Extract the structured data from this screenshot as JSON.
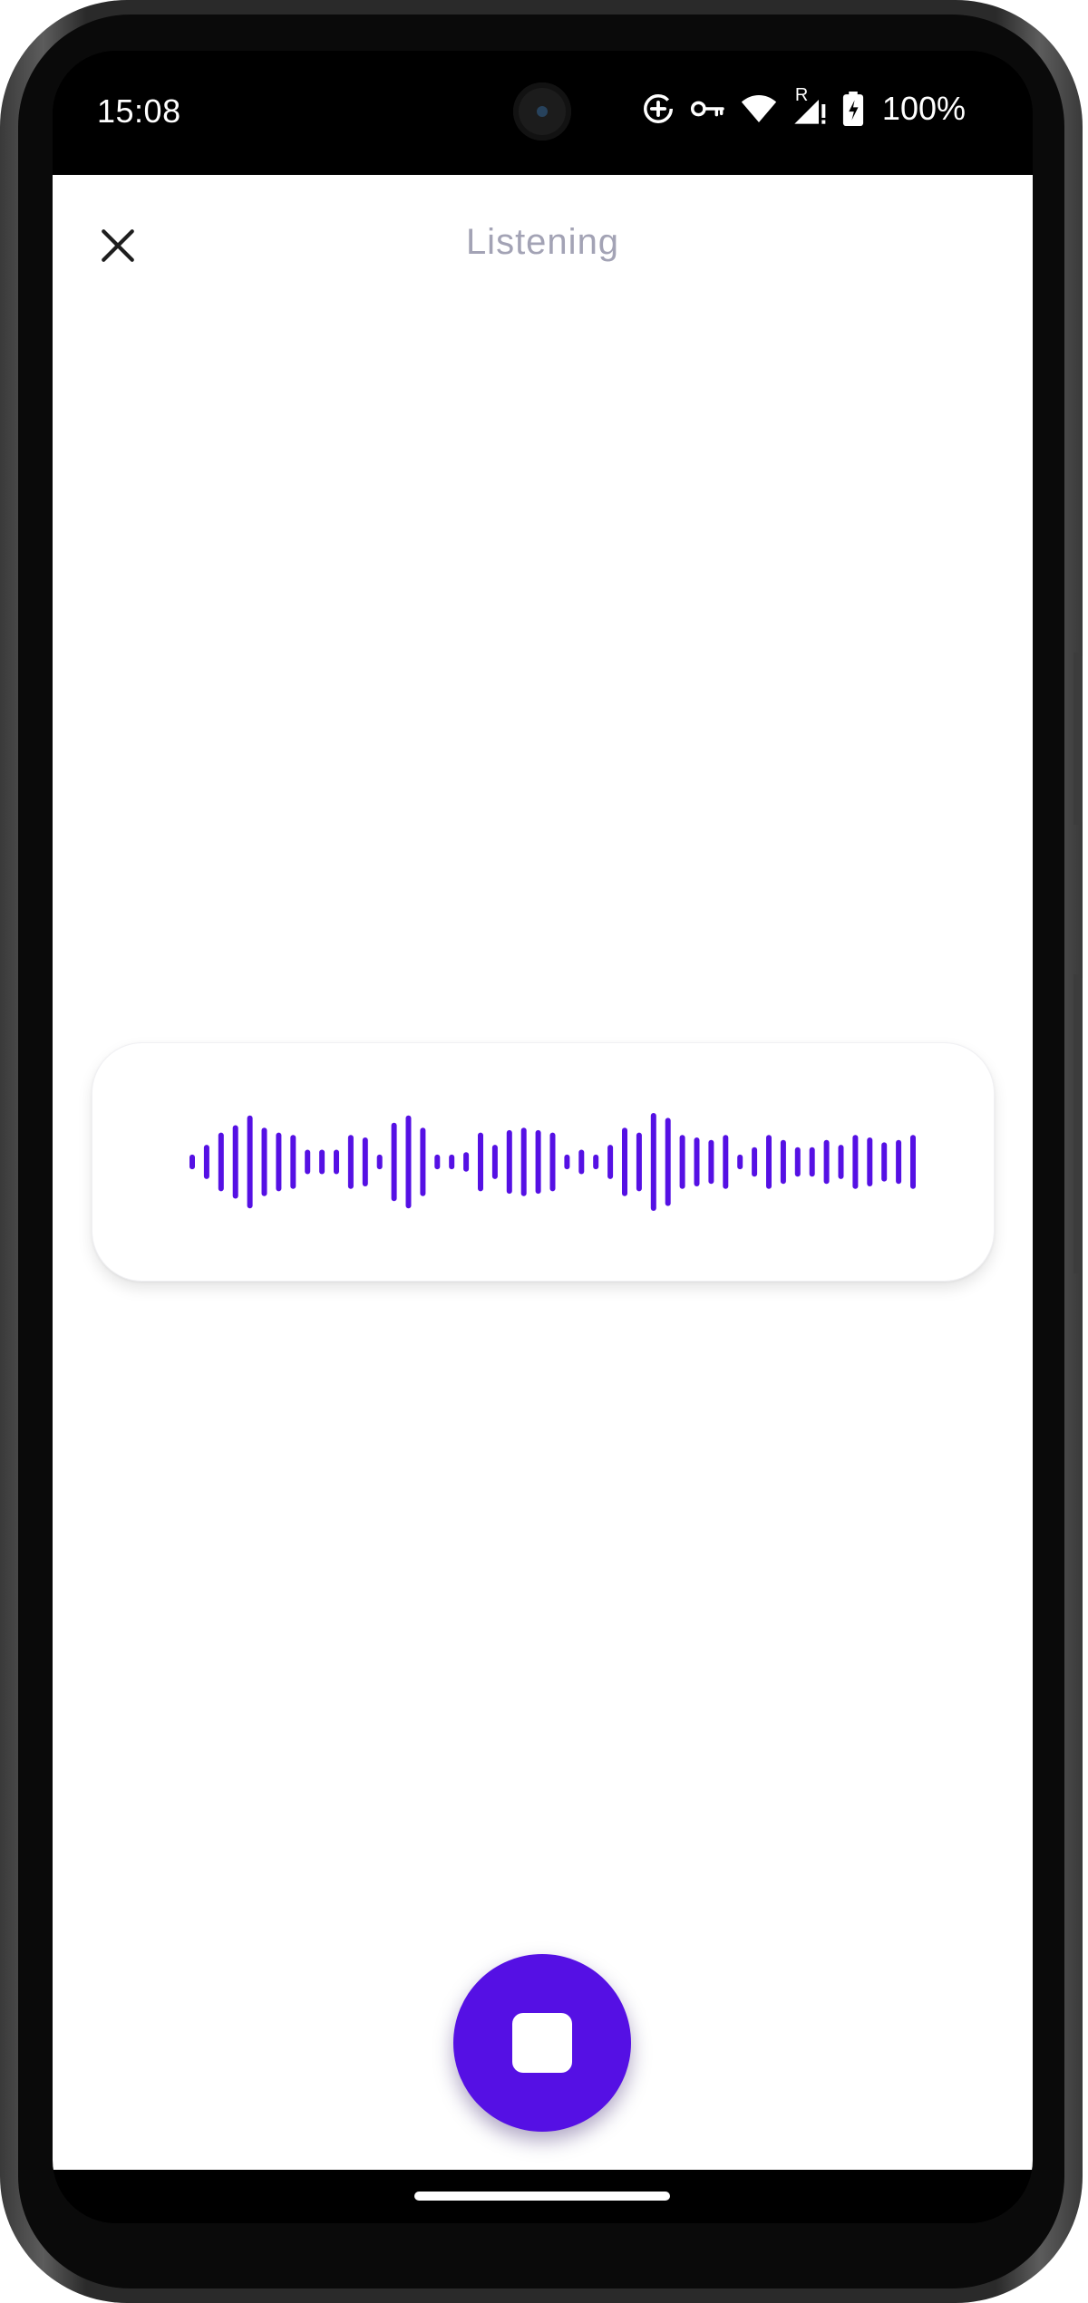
{
  "status_bar": {
    "time": "15:08",
    "battery_percent": "100%",
    "icons": [
      "data-saver-icon",
      "vpn-key-icon",
      "wifi-icon",
      "signal-roaming-icon",
      "battery-charging-icon"
    ],
    "roaming_label": "R"
  },
  "header": {
    "title": "Listening",
    "close_icon": "close-icon"
  },
  "waveform": {
    "color": "#5510e4",
    "bar_levels": [
      0.15,
      0.35,
      0.6,
      0.75,
      0.95,
      0.7,
      0.6,
      0.55,
      0.25,
      0.25,
      0.25,
      0.55,
      0.5,
      0.15,
      0.8,
      0.95,
      0.7,
      0.15,
      0.15,
      0.2,
      0.6,
      0.35,
      0.65,
      0.7,
      0.65,
      0.6,
      0.15,
      0.25,
      0.15,
      0.35,
      0.7,
      0.6,
      1.0,
      0.9,
      0.55,
      0.5,
      0.45,
      0.55,
      0.15,
      0.3,
      0.55,
      0.45,
      0.3,
      0.3,
      0.45,
      0.35,
      0.55,
      0.5,
      0.4,
      0.45,
      0.55
    ]
  },
  "controls": {
    "stop_icon": "stop-icon",
    "accent_color": "#5510e4"
  }
}
